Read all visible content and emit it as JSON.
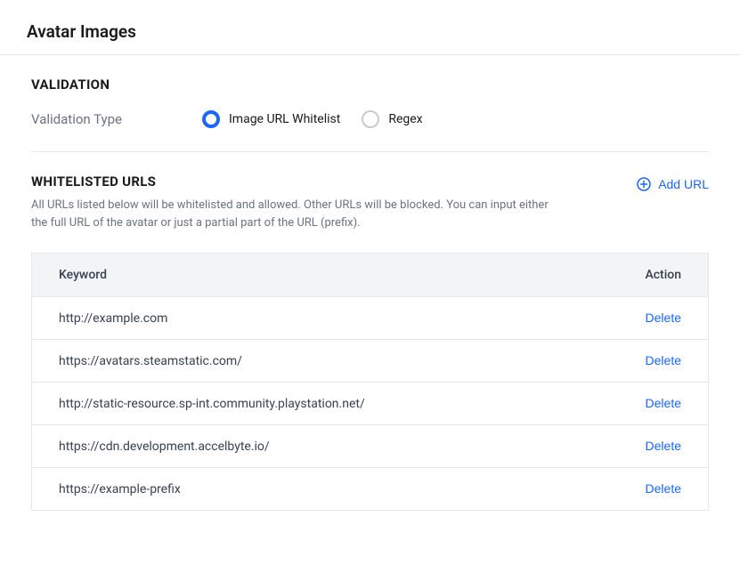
{
  "page_title": "Avatar Images",
  "validation": {
    "heading": "VALIDATION",
    "type_label": "Validation Type",
    "option_whitelist": "Image URL Whitelist",
    "option_regex": "Regex"
  },
  "whitelist": {
    "heading": "WHITELISTED URLS",
    "description": "All URLs listed below will be whitelisted and allowed. Other URLs will be blocked. You can input either the full URL of the avatar or just a partial part of the URL (prefix).",
    "add_url_label": "Add URL",
    "columns": {
      "keyword": "Keyword",
      "action": "Action"
    },
    "delete_label": "Delete",
    "rows": [
      {
        "keyword": "http://example.com"
      },
      {
        "keyword": "https://avatars.steamstatic.com/"
      },
      {
        "keyword": "http://static-resource.sp-int.community.playstation.net/"
      },
      {
        "keyword": "https://cdn.development.accelbyte.io/"
      },
      {
        "keyword": "https://example-prefix"
      }
    ]
  }
}
